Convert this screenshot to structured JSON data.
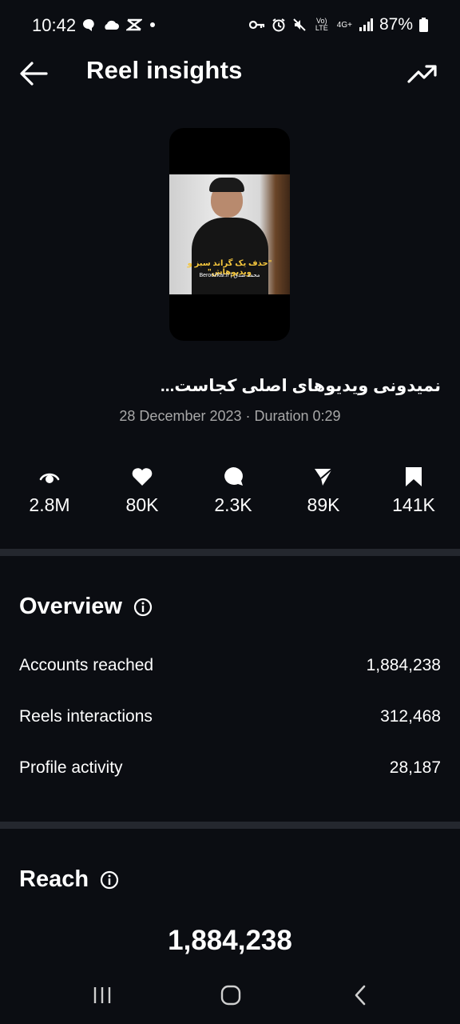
{
  "status_bar": {
    "time": "10:42",
    "left_icons": [
      "chat-bubble-icon",
      "cloud-icon",
      "capcut-icon",
      "dot-icon"
    ],
    "right_icons": [
      "key-icon",
      "alarm-icon",
      "mute-icon",
      "volte-icon",
      "4g-icon",
      "signal-icon"
    ],
    "volte_label": "Vo) LTE",
    "network_label": "4G+",
    "battery_text": "87%"
  },
  "header": {
    "title": "Reel insights",
    "back_icon": "arrow-left-icon",
    "trend_icon": "trending-up-icon"
  },
  "reel": {
    "caption_overlay": "\"حذف یک گراند سبز و ویدیوهاش\"",
    "subcaption_overlay": "Beroozkar.ir | محمد صدق",
    "description": "نمیدونی ویدیوهای اصلی کجاست...",
    "meta": "28 December 2023 · Duration 0:29"
  },
  "stats": [
    {
      "icon": "eye-icon",
      "value": "2.8M"
    },
    {
      "icon": "heart-icon",
      "value": "80K"
    },
    {
      "icon": "comment-icon",
      "value": "2.3K"
    },
    {
      "icon": "send-icon",
      "value": "89K"
    },
    {
      "icon": "bookmark-icon",
      "value": "141K"
    }
  ],
  "overview": {
    "title": "Overview",
    "rows": [
      {
        "label": "Accounts reached",
        "value": "1,884,238"
      },
      {
        "label": "Reels interactions",
        "value": "312,468"
      },
      {
        "label": "Profile activity",
        "value": "28,187"
      }
    ]
  },
  "reach": {
    "title": "Reach",
    "total": "1,884,238"
  },
  "navbar": {
    "icons": [
      "recent-apps-icon",
      "home-icon",
      "back-icon"
    ]
  }
}
